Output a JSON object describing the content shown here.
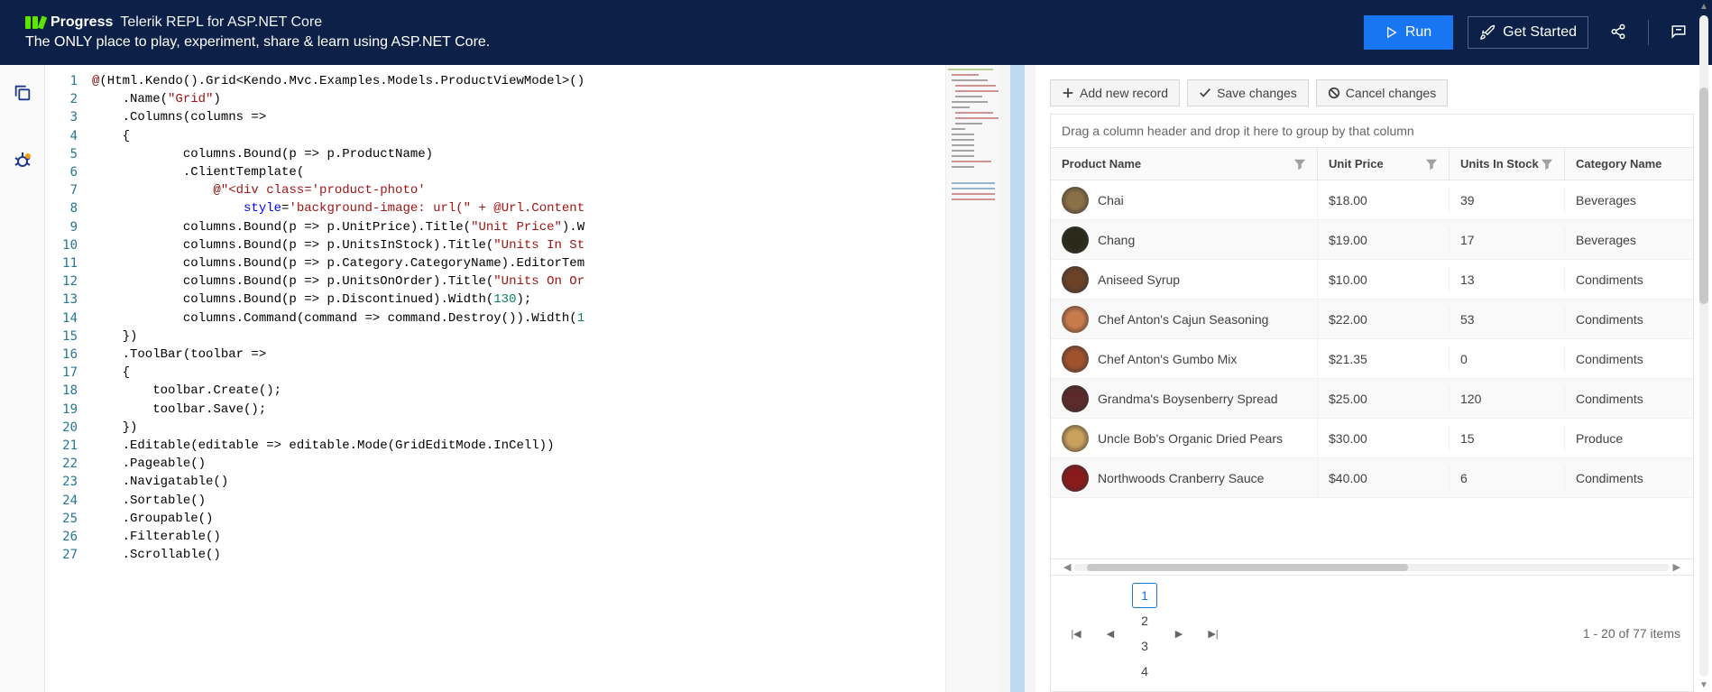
{
  "header": {
    "brand_progress": "Progress",
    "brand_product": "Telerik REPL for ASP.NET Core",
    "tagline": "The ONLY place to play, experiment, share & learn using ASP.NET Core.",
    "run_label": "Run",
    "get_started_label": "Get Started"
  },
  "editor": {
    "lines": [
      "@(Html.Kendo().Grid<Kendo.Mvc.Examples.Models.ProductViewModel>()",
      "    .Name(\"Grid\")",
      "    .Columns(columns =>",
      "    {",
      "            columns.Bound(p => p.ProductName)",
      "            .ClientTemplate(",
      "                @\"<div class='product-photo'",
      "                    style='background-image: url(\" + @Url.Content",
      "            columns.Bound(p => p.UnitPrice).Title(\"Unit Price\").W",
      "            columns.Bound(p => p.UnitsInStock).Title(\"Units In St",
      "            columns.Bound(p => p.Category.CategoryName).EditorTem",
      "            columns.Bound(p => p.UnitsOnOrder).Title(\"Units On Or",
      "            columns.Bound(p => p.Discontinued).Width(130);",
      "            columns.Command(command => command.Destroy()).Width(1",
      "    })",
      "    .ToolBar(toolbar =>",
      "    {",
      "        toolbar.Create();",
      "        toolbar.Save();",
      "    })",
      "    .Editable(editable => editable.Mode(GridEditMode.InCell))",
      "    .Pageable()",
      "    .Navigatable()",
      "    .Sortable()",
      "    .Groupable()",
      "    .Filterable()",
      "    .Scrollable()"
    ]
  },
  "grid": {
    "toolbar": {
      "add": "Add new record",
      "save": "Save changes",
      "cancel": "Cancel changes"
    },
    "group_hint": "Drag a column header and drop it here to group by that column",
    "columns": {
      "name": "Product Name",
      "price": "Unit Price",
      "stock": "Units In Stock",
      "cat": "Category Name"
    },
    "rows": [
      {
        "name": "Chai",
        "price": "$18.00",
        "stock": "39",
        "cat": "Beverages",
        "color": "#8b6f47"
      },
      {
        "name": "Chang",
        "price": "$19.00",
        "stock": "17",
        "cat": "Beverages",
        "color": "#2a2a1a"
      },
      {
        "name": "Aniseed Syrup",
        "price": "$10.00",
        "stock": "13",
        "cat": "Condiments",
        "color": "#6b4226"
      },
      {
        "name": "Chef Anton's Cajun Seasoning",
        "price": "$22.00",
        "stock": "53",
        "cat": "Condiments",
        "color": "#c97a4a"
      },
      {
        "name": "Chef Anton's Gumbo Mix",
        "price": "$21.35",
        "stock": "0",
        "cat": "Condiments",
        "color": "#a0522d"
      },
      {
        "name": "Grandma's Boysenberry Spread",
        "price": "$25.00",
        "stock": "120",
        "cat": "Condiments",
        "color": "#5c2a2a"
      },
      {
        "name": "Uncle Bob's Organic Dried Pears",
        "price": "$30.00",
        "stock": "15",
        "cat": "Produce",
        "color": "#c9a05c"
      },
      {
        "name": "Northwoods Cranberry Sauce",
        "price": "$40.00",
        "stock": "6",
        "cat": "Condiments",
        "color": "#8b1a1a"
      }
    ],
    "pager": {
      "pages": [
        "1",
        "2",
        "3",
        "4"
      ],
      "info": "1 - 20 of 77 items"
    }
  }
}
